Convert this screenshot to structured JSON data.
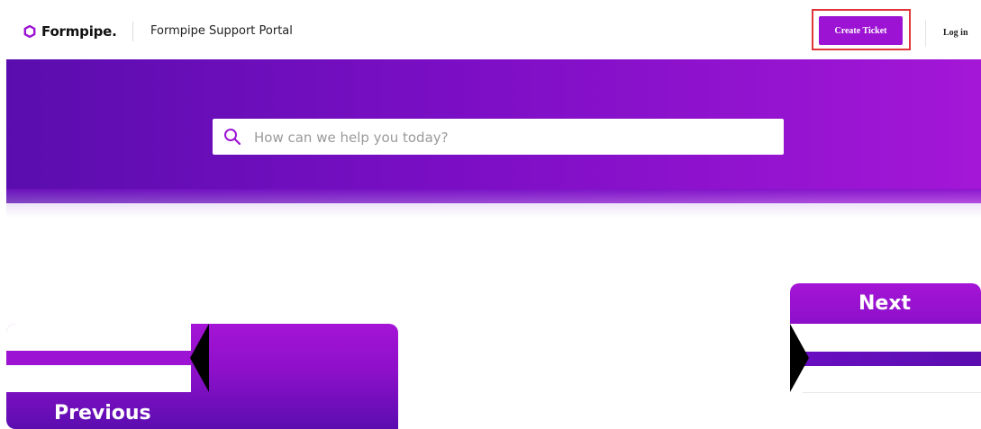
{
  "header": {
    "brand_name": "Formpipe.",
    "portal_title": "Formpipe Support Portal",
    "create_ticket_label": "Create Ticket",
    "login_label": "Log in"
  },
  "hero": {
    "search_placeholder": "How can we help you today?",
    "search_value": ""
  },
  "pagination": {
    "previous_label": "Previous",
    "next_label": "Next"
  },
  "colors": {
    "brand_purple": "#9c13d3",
    "hero_gradient_start": "#5a0dae",
    "hero_gradient_end": "#a417d7",
    "highlight_red": "#e0353a"
  },
  "icons": {
    "logo": "formpipe-logo-icon",
    "search": "search-icon",
    "prev_arrow": "arrow-left-icon",
    "next_arrow": "arrow-right-icon"
  }
}
